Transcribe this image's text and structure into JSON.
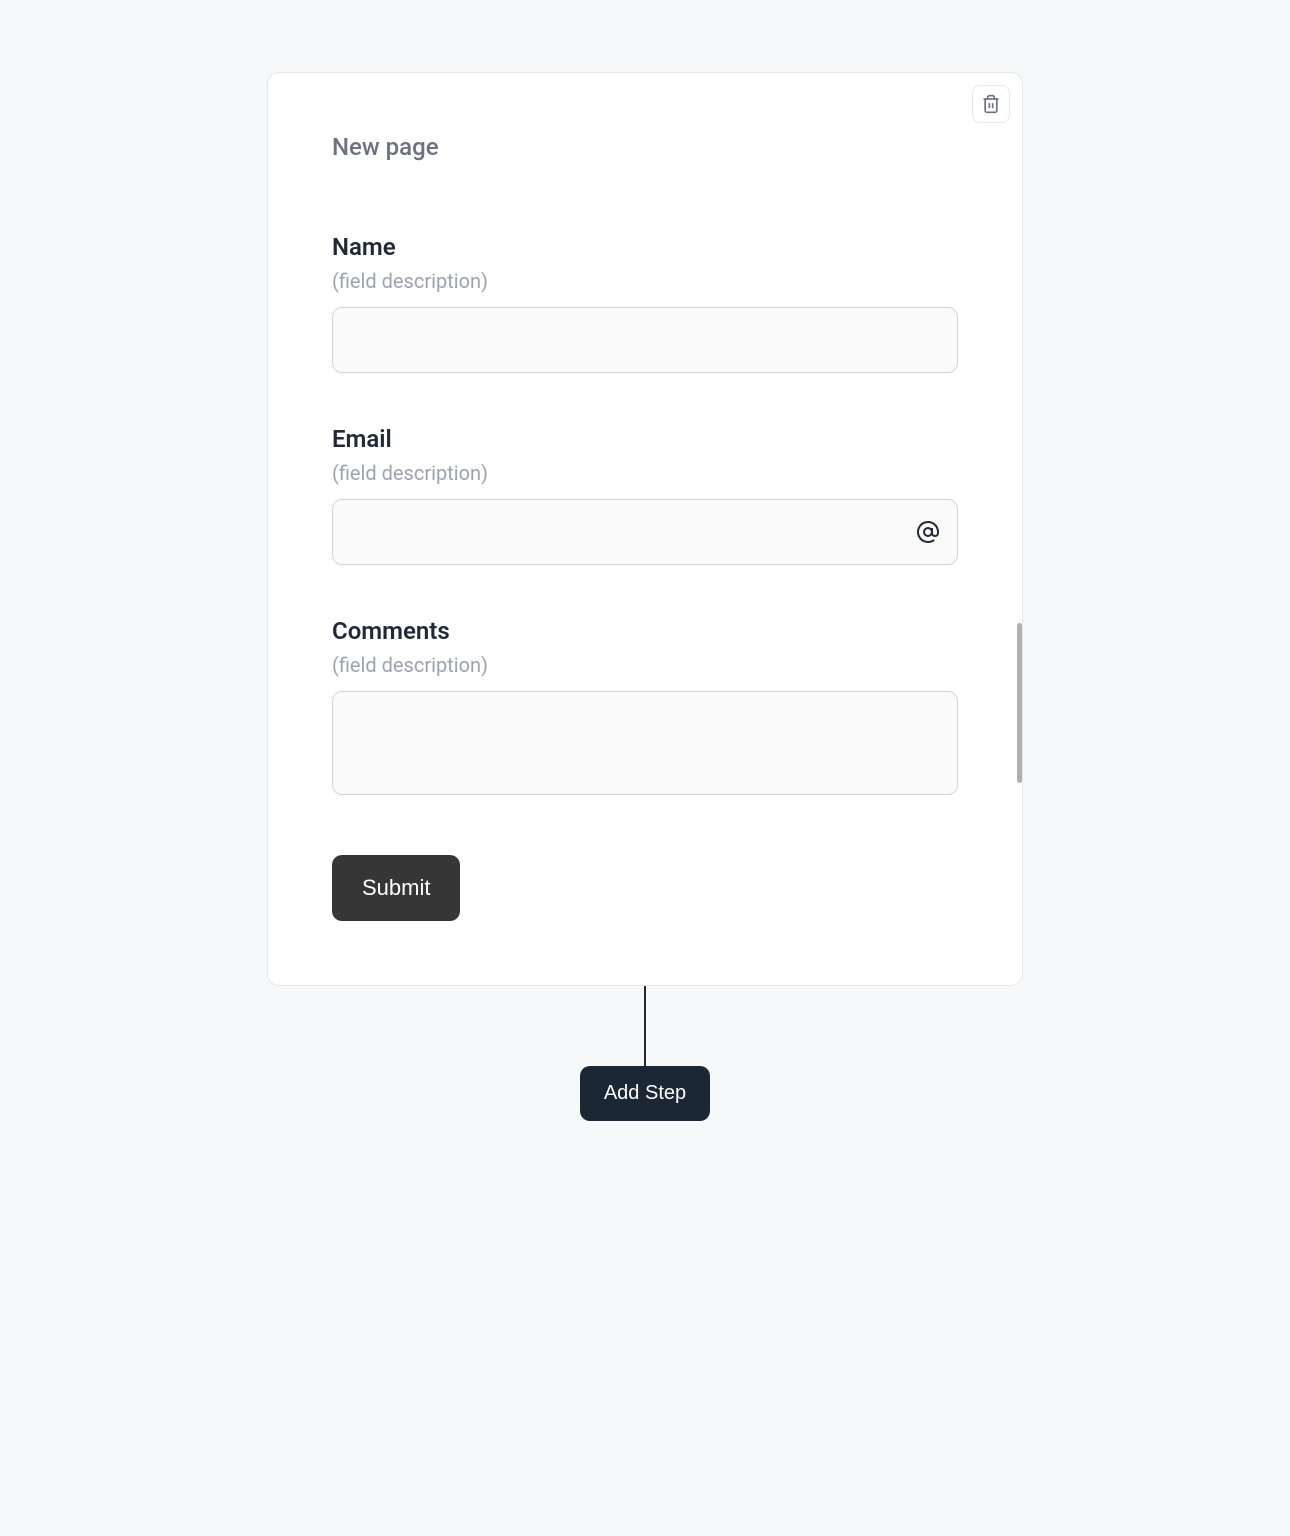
{
  "card": {
    "page_title": "New page",
    "fields": [
      {
        "label": "Name",
        "description": "(field description)",
        "value": ""
      },
      {
        "label": "Email",
        "description": "(field description)",
        "value": ""
      },
      {
        "label": "Comments",
        "description": "(field description)",
        "value": ""
      }
    ],
    "submit_label": "Submit"
  },
  "add_step_label": "Add Step"
}
